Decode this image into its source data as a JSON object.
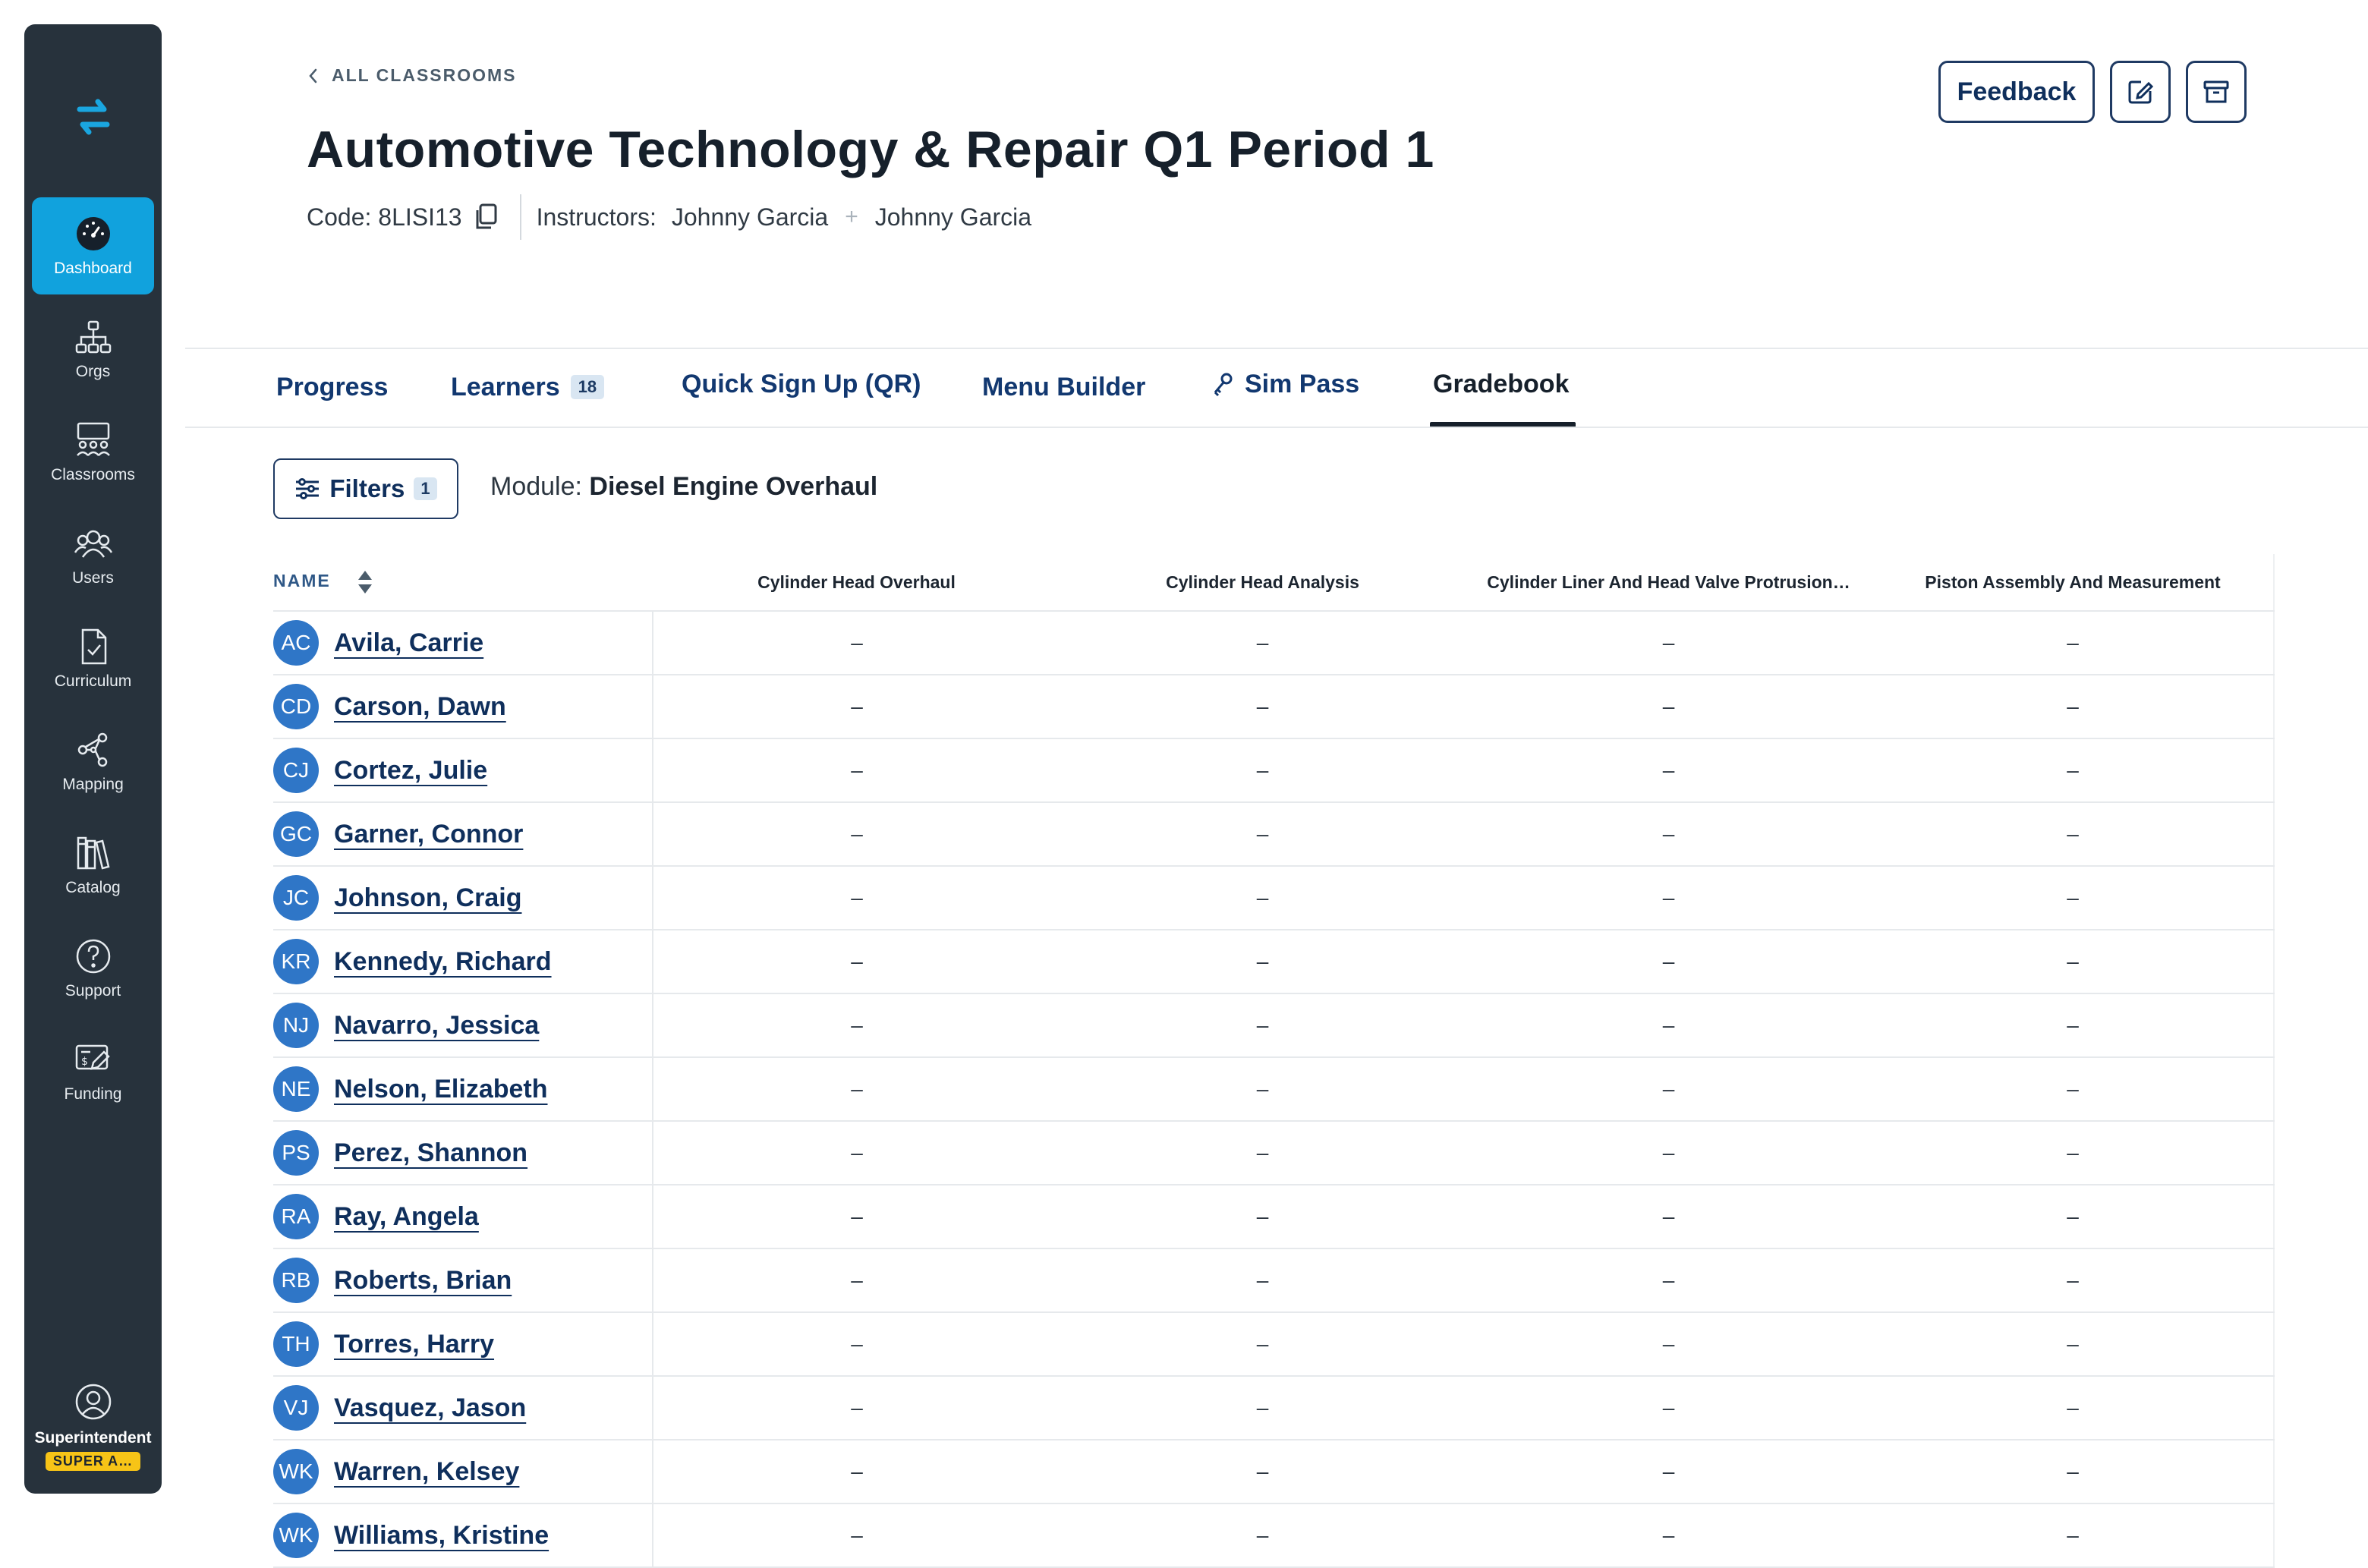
{
  "sidebar": {
    "items": [
      {
        "label": "Dashboard",
        "icon": "dashboard-gauge-icon"
      },
      {
        "label": "Orgs",
        "icon": "org-tree-icon"
      },
      {
        "label": "Classrooms",
        "icon": "classroom-icon"
      },
      {
        "label": "Users",
        "icon": "users-icon"
      },
      {
        "label": "Curriculum",
        "icon": "curriculum-file-check-icon"
      },
      {
        "label": "Mapping",
        "icon": "mapping-share-icon"
      },
      {
        "label": "Catalog",
        "icon": "catalog-books-icon"
      },
      {
        "label": "Support",
        "icon": "support-question-icon"
      },
      {
        "label": "Funding",
        "icon": "funding-dollar-icon"
      }
    ],
    "active": "Dashboard",
    "profile": {
      "name": "Superintendent",
      "badge": "SUPER A…"
    }
  },
  "header": {
    "back_label": "ALL CLASSROOMS",
    "title": "Automotive Technology & Repair Q1 Period 1",
    "code_label": "Code: 8LISI13",
    "instructors_label": "Instructors:",
    "instructors": [
      "Johnny Garcia",
      "Johnny Garcia"
    ],
    "feedback_label": "Feedback"
  },
  "tabs": [
    {
      "label": "Progress"
    },
    {
      "label": "Learners",
      "count": "18"
    },
    {
      "label": "Quick Sign Up (QR)"
    },
    {
      "label": "Menu Builder"
    },
    {
      "label": "Sim Pass"
    },
    {
      "label": "Gradebook",
      "active": true
    }
  ],
  "filters": {
    "label": "Filters",
    "count": "1",
    "module_prefix": "Module:",
    "module_name": "Diesel Engine Overhaul"
  },
  "table": {
    "name_header": "NAME",
    "columns": [
      "Cylinder Head Overhaul",
      "Cylinder Head Analysis",
      "Cylinder Liner And Head Valve Protrusion…",
      "Piston Assembly And Measurement"
    ],
    "rows": [
      {
        "initials": "AC",
        "name": "Avila, Carrie",
        "cells": [
          "–",
          "–",
          "–",
          "–"
        ]
      },
      {
        "initials": "CD",
        "name": "Carson, Dawn",
        "cells": [
          "–",
          "–",
          "–",
          "–"
        ]
      },
      {
        "initials": "CJ",
        "name": "Cortez, Julie",
        "cells": [
          "–",
          "–",
          "–",
          "–"
        ]
      },
      {
        "initials": "GC",
        "name": "Garner, Connor",
        "cells": [
          "–",
          "–",
          "–",
          "–"
        ]
      },
      {
        "initials": "JC",
        "name": "Johnson, Craig",
        "cells": [
          "–",
          "–",
          "–",
          "–"
        ]
      },
      {
        "initials": "KR",
        "name": "Kennedy, Richard",
        "cells": [
          "–",
          "–",
          "–",
          "–"
        ]
      },
      {
        "initials": "NJ",
        "name": "Navarro, Jessica",
        "cells": [
          "–",
          "–",
          "–",
          "–"
        ]
      },
      {
        "initials": "NE",
        "name": "Nelson, Elizabeth",
        "cells": [
          "–",
          "–",
          "–",
          "–"
        ]
      },
      {
        "initials": "PS",
        "name": "Perez, Shannon",
        "cells": [
          "–",
          "–",
          "–",
          "–"
        ]
      },
      {
        "initials": "RA",
        "name": "Ray, Angela",
        "cells": [
          "–",
          "–",
          "–",
          "–"
        ]
      },
      {
        "initials": "RB",
        "name": "Roberts, Brian",
        "cells": [
          "–",
          "–",
          "–",
          "–"
        ]
      },
      {
        "initials": "TH",
        "name": "Torres, Harry",
        "cells": [
          "–",
          "–",
          "–",
          "–"
        ]
      },
      {
        "initials": "VJ",
        "name": "Vasquez, Jason",
        "cells": [
          "–",
          "–",
          "–",
          "–"
        ]
      },
      {
        "initials": "WK",
        "name": "Warren, Kelsey",
        "cells": [
          "–",
          "–",
          "–",
          "–"
        ]
      },
      {
        "initials": "WK",
        "name": "Williams, Kristine",
        "cells": [
          "–",
          "–",
          "–",
          "–"
        ]
      }
    ]
  },
  "colors": {
    "sidebar_bg": "#27323c",
    "accent": "#11a2dd",
    "primary_text": "#0f2f5c",
    "avatar": "#2f76c7",
    "badge": "#f7c417"
  }
}
